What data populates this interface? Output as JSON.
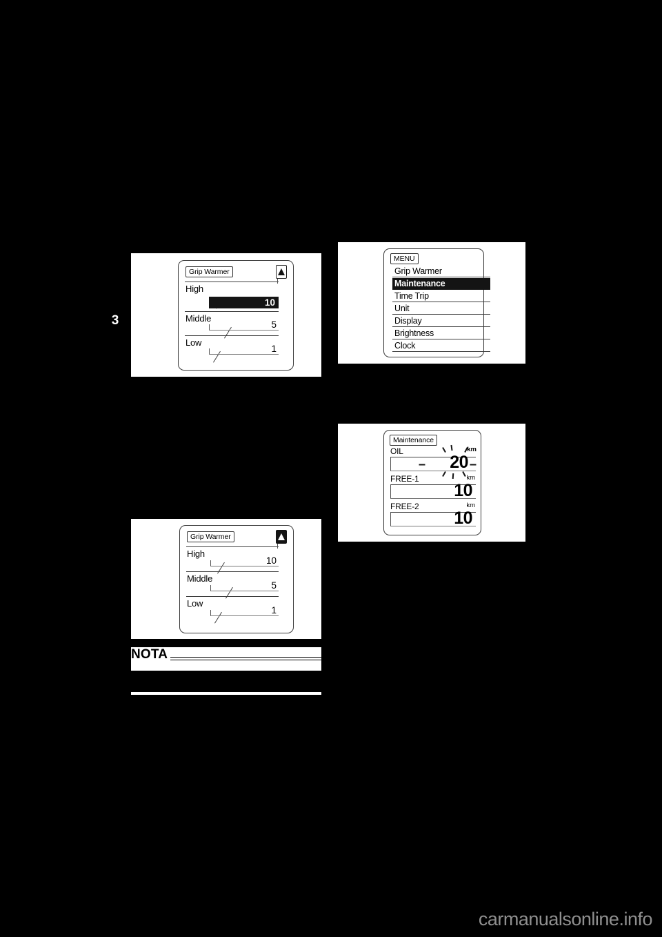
{
  "page": {
    "chapter_number": "3",
    "background_color": "#000000",
    "paper_color": "#ffffff"
  },
  "figures": {
    "grip_warmer_high": {
      "title": "Grip Warmer",
      "arrow_icon": "up-triangle-icon",
      "arrow_inverted": false,
      "levels": [
        {
          "label": "High",
          "value": "10",
          "selected": true
        },
        {
          "label": "Middle",
          "value": "5",
          "selected": false
        },
        {
          "label": "Low",
          "value": "1",
          "selected": false
        }
      ]
    },
    "menu": {
      "title": "MENU",
      "items": [
        {
          "label": "Grip Warmer",
          "selected": false
        },
        {
          "label": "Maintenance",
          "selected": true
        },
        {
          "label": "Time Trip",
          "selected": false
        },
        {
          "label": "Unit",
          "selected": false
        },
        {
          "label": "Display",
          "selected": false
        },
        {
          "label": "Brightness",
          "selected": false
        },
        {
          "label": "Clock",
          "selected": false
        }
      ]
    },
    "grip_warmer_plain": {
      "title": "Grip Warmer",
      "arrow_icon": "up-triangle-icon",
      "arrow_inverted": true,
      "levels": [
        {
          "label": "High",
          "value": "10",
          "selected": false
        },
        {
          "label": "Middle",
          "value": "5",
          "selected": false
        },
        {
          "label": "Low",
          "value": "1",
          "selected": false
        }
      ]
    },
    "maintenance": {
      "title": "Maintenance",
      "rows": [
        {
          "label": "OIL",
          "value": "20",
          "unit": "km",
          "flashing": true
        },
        {
          "label": "FREE-1",
          "value": "10",
          "unit": "km",
          "flashing": false
        },
        {
          "label": "FREE-2",
          "value": "10",
          "unit": "km",
          "flashing": false
        }
      ]
    }
  },
  "nota": {
    "heading": "NOTA",
    "body_line": ""
  },
  "footer": {
    "watermark": "carmanualsonline.info",
    "watermark_color": "#8f8f8f"
  }
}
